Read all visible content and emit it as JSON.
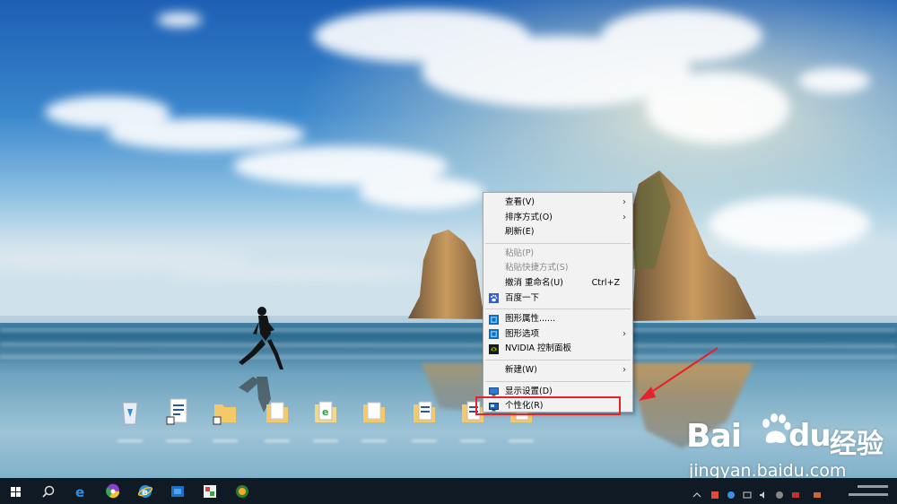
{
  "desktop": {
    "icons": [
      {
        "name": "recycle-bin-icon"
      },
      {
        "name": "document-shortcut-icon"
      },
      {
        "name": "folder-shortcut-icon"
      },
      {
        "name": "folder-icon"
      },
      {
        "name": "image-folder-icon"
      },
      {
        "name": "folder-icon"
      },
      {
        "name": "document-folder-icon"
      },
      {
        "name": "document-folder-icon"
      },
      {
        "name": "document-folder-icon"
      }
    ]
  },
  "context_menu": {
    "items": [
      {
        "label": "查看(V)",
        "submenu": true,
        "disabled": false,
        "icon": ""
      },
      {
        "label": "排序方式(O)",
        "submenu": true,
        "disabled": false,
        "icon": ""
      },
      {
        "label": "刷新(E)",
        "submenu": false,
        "disabled": false,
        "icon": ""
      },
      {
        "separator": true
      },
      {
        "label": "粘贴(P)",
        "submenu": false,
        "disabled": true,
        "icon": ""
      },
      {
        "label": "粘贴快捷方式(S)",
        "submenu": false,
        "disabled": true,
        "icon": ""
      },
      {
        "label": "撤消 重命名(U)",
        "shortcut": "Ctrl+Z",
        "submenu": false,
        "disabled": false,
        "icon": ""
      },
      {
        "label": "百度一下",
        "submenu": false,
        "disabled": false,
        "icon": "baidu-paw-icon"
      },
      {
        "separator": true
      },
      {
        "label": "图形属性......",
        "submenu": false,
        "disabled": false,
        "icon": "intel-graphics-icon"
      },
      {
        "label": "图形选项",
        "submenu": true,
        "disabled": false,
        "icon": "intel-graphics-icon"
      },
      {
        "label": "NVIDIA 控制面板",
        "submenu": false,
        "disabled": false,
        "icon": "nvidia-icon"
      },
      {
        "separator": true
      },
      {
        "label": "新建(W)",
        "submenu": true,
        "disabled": false,
        "icon": ""
      },
      {
        "separator": true
      },
      {
        "label": "显示设置(D)",
        "submenu": false,
        "disabled": false,
        "icon": "display-settings-icon"
      },
      {
        "label": "个性化(R)",
        "submenu": false,
        "disabled": false,
        "icon": "personalize-icon",
        "highlighted": true
      }
    ],
    "arrow_glyph": "›"
  },
  "annotation": {
    "color": "#e3242b"
  },
  "taskbar": {
    "buttons": [
      {
        "name": "start-button"
      },
      {
        "name": "search-button"
      },
      {
        "name": "edge-taskbar-icon"
      },
      {
        "name": "chrome-like-taskbar-icon"
      },
      {
        "name": "ie-taskbar-icon"
      },
      {
        "name": "store-taskbar-icon"
      },
      {
        "name": "photos-taskbar-icon"
      },
      {
        "name": "app-taskbar-icon"
      }
    ]
  },
  "watermark": {
    "brand": "Bai",
    "brand_suffix": "du",
    "product": "经验",
    "url": "jingyan.baidu.com"
  },
  "colors": {
    "menu_bg": "#f2f2f2",
    "taskbar_bg": "#101a24",
    "highlight_border": "#e3242b"
  }
}
